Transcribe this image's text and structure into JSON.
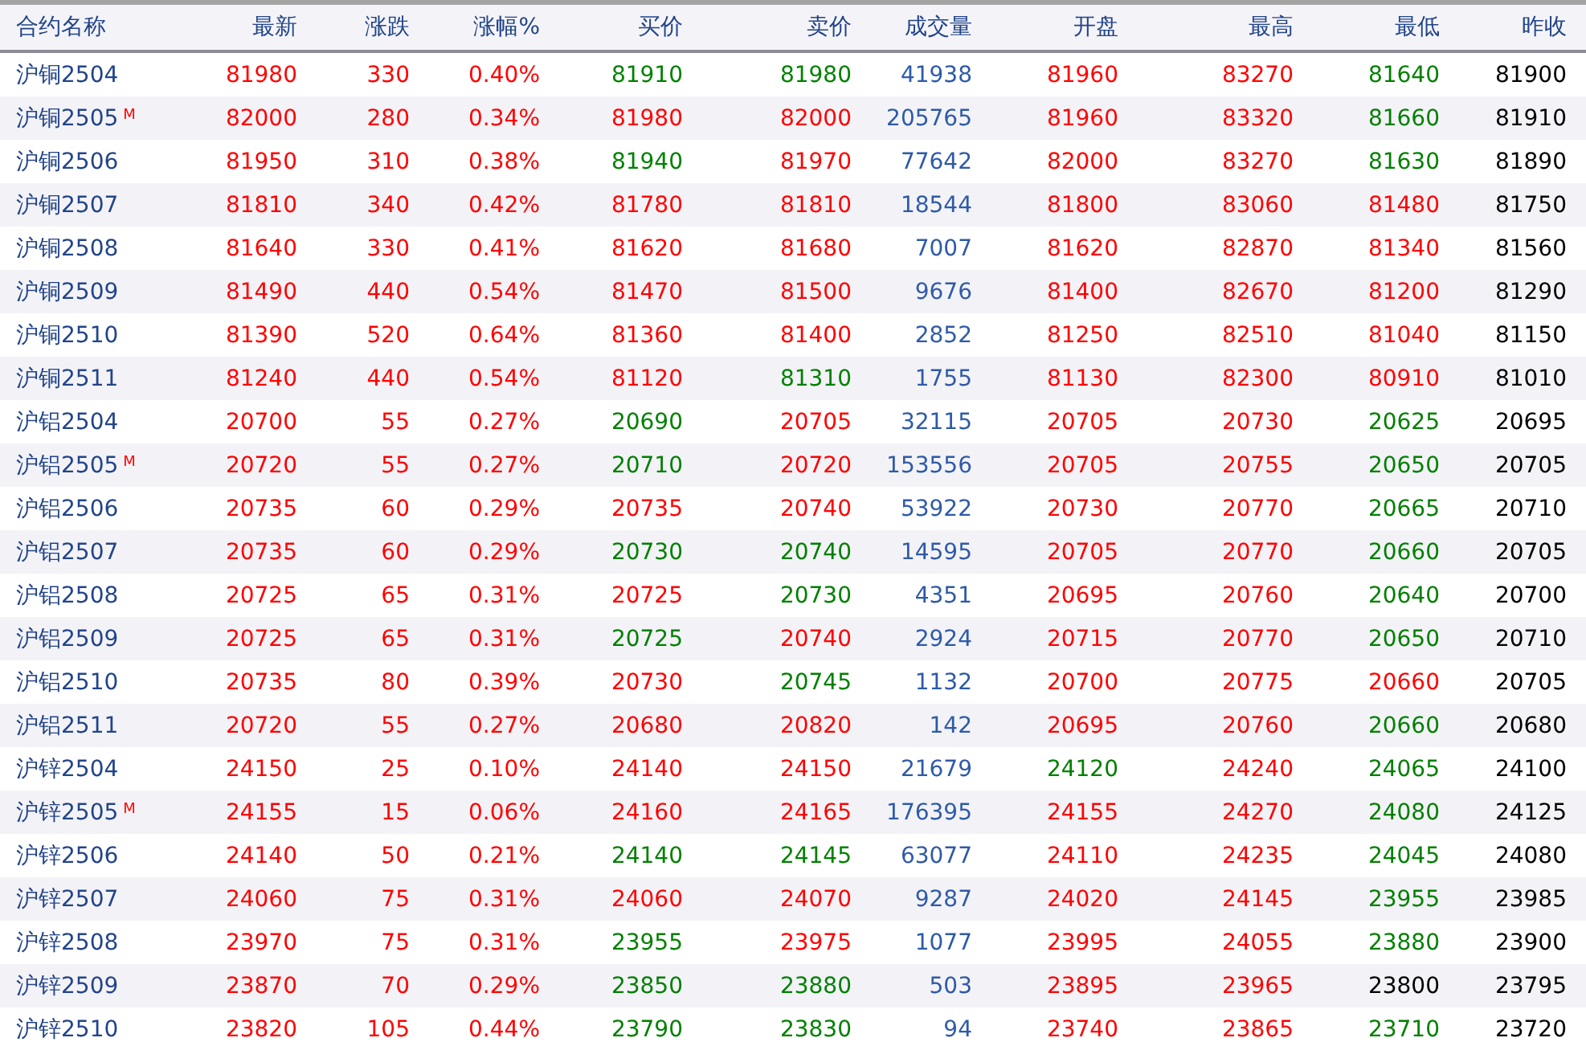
{
  "table": {
    "name_header": "合约名称",
    "columns": [
      "最新",
      "涨跌",
      "涨幅%",
      "买价",
      "卖价",
      "成交量",
      "开盘",
      "最高",
      "最低",
      "昨收"
    ],
    "rows": [
      {
        "name": "沪铜2504",
        "cells": [
          {
            "text": "81980",
            "color": "#ff0000"
          },
          {
            "text": "330",
            "color": "#ff0000"
          },
          {
            "text": "0.40%",
            "color": "#ff0000"
          },
          {
            "text": "81910",
            "color": "#008000"
          },
          {
            "text": "81980",
            "color": "#008000"
          },
          {
            "text": "41938",
            "color": "#2e5aa8"
          },
          {
            "text": "81960",
            "color": "#ff0000"
          },
          {
            "text": "83270",
            "color": "#ff0000"
          },
          {
            "text": "81640",
            "color": "#008000"
          },
          {
            "text": "81900",
            "color": "#000000"
          }
        ]
      },
      {
        "name": "沪铜2505",
        "badge": "M",
        "cells": [
          {
            "text": "82000",
            "color": "#ff0000"
          },
          {
            "text": "280",
            "color": "#ff0000"
          },
          {
            "text": "0.34%",
            "color": "#ff0000"
          },
          {
            "text": "81980",
            "color": "#ff0000"
          },
          {
            "text": "82000",
            "color": "#ff0000"
          },
          {
            "text": "205765",
            "color": "#2e5aa8"
          },
          {
            "text": "81960",
            "color": "#ff0000"
          },
          {
            "text": "83320",
            "color": "#ff0000"
          },
          {
            "text": "81660",
            "color": "#008000"
          },
          {
            "text": "81910",
            "color": "#000000"
          }
        ]
      },
      {
        "name": "沪铜2506",
        "cells": [
          {
            "text": "81950",
            "color": "#ff0000"
          },
          {
            "text": "310",
            "color": "#ff0000"
          },
          {
            "text": "0.38%",
            "color": "#ff0000"
          },
          {
            "text": "81940",
            "color": "#008000"
          },
          {
            "text": "81970",
            "color": "#ff0000"
          },
          {
            "text": "77642",
            "color": "#2e5aa8"
          },
          {
            "text": "82000",
            "color": "#ff0000"
          },
          {
            "text": "83270",
            "color": "#ff0000"
          },
          {
            "text": "81630",
            "color": "#008000"
          },
          {
            "text": "81890",
            "color": "#000000"
          }
        ]
      },
      {
        "name": "沪铜2507",
        "cells": [
          {
            "text": "81810",
            "color": "#ff0000"
          },
          {
            "text": "340",
            "color": "#ff0000"
          },
          {
            "text": "0.42%",
            "color": "#ff0000"
          },
          {
            "text": "81780",
            "color": "#ff0000"
          },
          {
            "text": "81810",
            "color": "#ff0000"
          },
          {
            "text": "18544",
            "color": "#2e5aa8"
          },
          {
            "text": "81800",
            "color": "#ff0000"
          },
          {
            "text": "83060",
            "color": "#ff0000"
          },
          {
            "text": "81480",
            "color": "#ff0000"
          },
          {
            "text": "81750",
            "color": "#000000"
          }
        ]
      },
      {
        "name": "沪铜2508",
        "cells": [
          {
            "text": "81640",
            "color": "#ff0000"
          },
          {
            "text": "330",
            "color": "#ff0000"
          },
          {
            "text": "0.41%",
            "color": "#ff0000"
          },
          {
            "text": "81620",
            "color": "#ff0000"
          },
          {
            "text": "81680",
            "color": "#ff0000"
          },
          {
            "text": "7007",
            "color": "#2e5aa8"
          },
          {
            "text": "81620",
            "color": "#ff0000"
          },
          {
            "text": "82870",
            "color": "#ff0000"
          },
          {
            "text": "81340",
            "color": "#ff0000"
          },
          {
            "text": "81560",
            "color": "#000000"
          }
        ]
      },
      {
        "name": "沪铜2509",
        "cells": [
          {
            "text": "81490",
            "color": "#ff0000"
          },
          {
            "text": "440",
            "color": "#ff0000"
          },
          {
            "text": "0.54%",
            "color": "#ff0000"
          },
          {
            "text": "81470",
            "color": "#ff0000"
          },
          {
            "text": "81500",
            "color": "#ff0000"
          },
          {
            "text": "9676",
            "color": "#2e5aa8"
          },
          {
            "text": "81400",
            "color": "#ff0000"
          },
          {
            "text": "82670",
            "color": "#ff0000"
          },
          {
            "text": "81200",
            "color": "#ff0000"
          },
          {
            "text": "81290",
            "color": "#000000"
          }
        ]
      },
      {
        "name": "沪铜2510",
        "cells": [
          {
            "text": "81390",
            "color": "#ff0000"
          },
          {
            "text": "520",
            "color": "#ff0000"
          },
          {
            "text": "0.64%",
            "color": "#ff0000"
          },
          {
            "text": "81360",
            "color": "#ff0000"
          },
          {
            "text": "81400",
            "color": "#ff0000"
          },
          {
            "text": "2852",
            "color": "#2e5aa8"
          },
          {
            "text": "81250",
            "color": "#ff0000"
          },
          {
            "text": "82510",
            "color": "#ff0000"
          },
          {
            "text": "81040",
            "color": "#ff0000"
          },
          {
            "text": "81150",
            "color": "#000000"
          }
        ]
      },
      {
        "name": "沪铜2511",
        "cells": [
          {
            "text": "81240",
            "color": "#ff0000"
          },
          {
            "text": "440",
            "color": "#ff0000"
          },
          {
            "text": "0.54%",
            "color": "#ff0000"
          },
          {
            "text": "81120",
            "color": "#ff0000"
          },
          {
            "text": "81310",
            "color": "#008000"
          },
          {
            "text": "1755",
            "color": "#2e5aa8"
          },
          {
            "text": "81130",
            "color": "#ff0000"
          },
          {
            "text": "82300",
            "color": "#ff0000"
          },
          {
            "text": "80910",
            "color": "#ff0000"
          },
          {
            "text": "81010",
            "color": "#000000"
          }
        ]
      },
      {
        "name": "沪铝2504",
        "cells": [
          {
            "text": "20700",
            "color": "#ff0000"
          },
          {
            "text": "55",
            "color": "#ff0000"
          },
          {
            "text": "0.27%",
            "color": "#ff0000"
          },
          {
            "text": "20690",
            "color": "#008000"
          },
          {
            "text": "20705",
            "color": "#ff0000"
          },
          {
            "text": "32115",
            "color": "#2e5aa8"
          },
          {
            "text": "20705",
            "color": "#ff0000"
          },
          {
            "text": "20730",
            "color": "#ff0000"
          },
          {
            "text": "20625",
            "color": "#008000"
          },
          {
            "text": "20695",
            "color": "#000000"
          }
        ]
      },
      {
        "name": "沪铝2505",
        "badge": "M",
        "cells": [
          {
            "text": "20720",
            "color": "#ff0000"
          },
          {
            "text": "55",
            "color": "#ff0000"
          },
          {
            "text": "0.27%",
            "color": "#ff0000"
          },
          {
            "text": "20710",
            "color": "#008000"
          },
          {
            "text": "20720",
            "color": "#ff0000"
          },
          {
            "text": "153556",
            "color": "#2e5aa8"
          },
          {
            "text": "20705",
            "color": "#ff0000"
          },
          {
            "text": "20755",
            "color": "#ff0000"
          },
          {
            "text": "20650",
            "color": "#008000"
          },
          {
            "text": "20705",
            "color": "#000000"
          }
        ]
      },
      {
        "name": "沪铝2506",
        "cells": [
          {
            "text": "20735",
            "color": "#ff0000"
          },
          {
            "text": "60",
            "color": "#ff0000"
          },
          {
            "text": "0.29%",
            "color": "#ff0000"
          },
          {
            "text": "20735",
            "color": "#ff0000"
          },
          {
            "text": "20740",
            "color": "#ff0000"
          },
          {
            "text": "53922",
            "color": "#2e5aa8"
          },
          {
            "text": "20730",
            "color": "#ff0000"
          },
          {
            "text": "20770",
            "color": "#ff0000"
          },
          {
            "text": "20665",
            "color": "#008000"
          },
          {
            "text": "20710",
            "color": "#000000"
          }
        ]
      },
      {
        "name": "沪铝2507",
        "cells": [
          {
            "text": "20735",
            "color": "#ff0000"
          },
          {
            "text": "60",
            "color": "#ff0000"
          },
          {
            "text": "0.29%",
            "color": "#ff0000"
          },
          {
            "text": "20730",
            "color": "#008000"
          },
          {
            "text": "20740",
            "color": "#008000"
          },
          {
            "text": "14595",
            "color": "#2e5aa8"
          },
          {
            "text": "20705",
            "color": "#ff0000"
          },
          {
            "text": "20770",
            "color": "#ff0000"
          },
          {
            "text": "20660",
            "color": "#008000"
          },
          {
            "text": "20705",
            "color": "#000000"
          }
        ]
      },
      {
        "name": "沪铝2508",
        "cells": [
          {
            "text": "20725",
            "color": "#ff0000"
          },
          {
            "text": "65",
            "color": "#ff0000"
          },
          {
            "text": "0.31%",
            "color": "#ff0000"
          },
          {
            "text": "20725",
            "color": "#ff0000"
          },
          {
            "text": "20730",
            "color": "#008000"
          },
          {
            "text": "4351",
            "color": "#2e5aa8"
          },
          {
            "text": "20695",
            "color": "#ff0000"
          },
          {
            "text": "20760",
            "color": "#ff0000"
          },
          {
            "text": "20640",
            "color": "#008000"
          },
          {
            "text": "20700",
            "color": "#000000"
          }
        ]
      },
      {
        "name": "沪铝2509",
        "cells": [
          {
            "text": "20725",
            "color": "#ff0000"
          },
          {
            "text": "65",
            "color": "#ff0000"
          },
          {
            "text": "0.31%",
            "color": "#ff0000"
          },
          {
            "text": "20725",
            "color": "#008000"
          },
          {
            "text": "20740",
            "color": "#ff0000"
          },
          {
            "text": "2924",
            "color": "#2e5aa8"
          },
          {
            "text": "20715",
            "color": "#ff0000"
          },
          {
            "text": "20770",
            "color": "#ff0000"
          },
          {
            "text": "20650",
            "color": "#008000"
          },
          {
            "text": "20710",
            "color": "#000000"
          }
        ]
      },
      {
        "name": "沪铝2510",
        "cells": [
          {
            "text": "20735",
            "color": "#ff0000"
          },
          {
            "text": "80",
            "color": "#ff0000"
          },
          {
            "text": "0.39%",
            "color": "#ff0000"
          },
          {
            "text": "20730",
            "color": "#ff0000"
          },
          {
            "text": "20745",
            "color": "#008000"
          },
          {
            "text": "1132",
            "color": "#2e5aa8"
          },
          {
            "text": "20700",
            "color": "#ff0000"
          },
          {
            "text": "20775",
            "color": "#ff0000"
          },
          {
            "text": "20660",
            "color": "#ff0000"
          },
          {
            "text": "20705",
            "color": "#000000"
          }
        ]
      },
      {
        "name": "沪铝2511",
        "cells": [
          {
            "text": "20720",
            "color": "#ff0000"
          },
          {
            "text": "55",
            "color": "#ff0000"
          },
          {
            "text": "0.27%",
            "color": "#ff0000"
          },
          {
            "text": "20680",
            "color": "#ff0000"
          },
          {
            "text": "20820",
            "color": "#ff0000"
          },
          {
            "text": "142",
            "color": "#2e5aa8"
          },
          {
            "text": "20695",
            "color": "#ff0000"
          },
          {
            "text": "20760",
            "color": "#ff0000"
          },
          {
            "text": "20660",
            "color": "#008000"
          },
          {
            "text": "20680",
            "color": "#000000"
          }
        ]
      },
      {
        "name": "沪锌2504",
        "cells": [
          {
            "text": "24150",
            "color": "#ff0000"
          },
          {
            "text": "25",
            "color": "#ff0000"
          },
          {
            "text": "0.10%",
            "color": "#ff0000"
          },
          {
            "text": "24140",
            "color": "#ff0000"
          },
          {
            "text": "24150",
            "color": "#ff0000"
          },
          {
            "text": "21679",
            "color": "#2e5aa8"
          },
          {
            "text": "24120",
            "color": "#008000"
          },
          {
            "text": "24240",
            "color": "#ff0000"
          },
          {
            "text": "24065",
            "color": "#008000"
          },
          {
            "text": "24100",
            "color": "#000000"
          }
        ]
      },
      {
        "name": "沪锌2505",
        "badge": "M",
        "cells": [
          {
            "text": "24155",
            "color": "#ff0000"
          },
          {
            "text": "15",
            "color": "#ff0000"
          },
          {
            "text": "0.06%",
            "color": "#ff0000"
          },
          {
            "text": "24160",
            "color": "#ff0000"
          },
          {
            "text": "24165",
            "color": "#ff0000"
          },
          {
            "text": "176395",
            "color": "#2e5aa8"
          },
          {
            "text": "24155",
            "color": "#ff0000"
          },
          {
            "text": "24270",
            "color": "#ff0000"
          },
          {
            "text": "24080",
            "color": "#008000"
          },
          {
            "text": "24125",
            "color": "#000000"
          }
        ]
      },
      {
        "name": "沪锌2506",
        "cells": [
          {
            "text": "24140",
            "color": "#ff0000"
          },
          {
            "text": "50",
            "color": "#ff0000"
          },
          {
            "text": "0.21%",
            "color": "#ff0000"
          },
          {
            "text": "24140",
            "color": "#008000"
          },
          {
            "text": "24145",
            "color": "#008000"
          },
          {
            "text": "63077",
            "color": "#2e5aa8"
          },
          {
            "text": "24110",
            "color": "#ff0000"
          },
          {
            "text": "24235",
            "color": "#ff0000"
          },
          {
            "text": "24045",
            "color": "#008000"
          },
          {
            "text": "24080",
            "color": "#000000"
          }
        ]
      },
      {
        "name": "沪锌2507",
        "cells": [
          {
            "text": "24060",
            "color": "#ff0000"
          },
          {
            "text": "75",
            "color": "#ff0000"
          },
          {
            "text": "0.31%",
            "color": "#ff0000"
          },
          {
            "text": "24060",
            "color": "#ff0000"
          },
          {
            "text": "24070",
            "color": "#ff0000"
          },
          {
            "text": "9287",
            "color": "#2e5aa8"
          },
          {
            "text": "24020",
            "color": "#ff0000"
          },
          {
            "text": "24145",
            "color": "#ff0000"
          },
          {
            "text": "23955",
            "color": "#008000"
          },
          {
            "text": "23985",
            "color": "#000000"
          }
        ]
      },
      {
        "name": "沪锌2508",
        "cells": [
          {
            "text": "23970",
            "color": "#ff0000"
          },
          {
            "text": "75",
            "color": "#ff0000"
          },
          {
            "text": "0.31%",
            "color": "#ff0000"
          },
          {
            "text": "23955",
            "color": "#008000"
          },
          {
            "text": "23975",
            "color": "#ff0000"
          },
          {
            "text": "1077",
            "color": "#2e5aa8"
          },
          {
            "text": "23995",
            "color": "#ff0000"
          },
          {
            "text": "24055",
            "color": "#ff0000"
          },
          {
            "text": "23880",
            "color": "#008000"
          },
          {
            "text": "23900",
            "color": "#000000"
          }
        ]
      },
      {
        "name": "沪锌2509",
        "cells": [
          {
            "text": "23870",
            "color": "#ff0000"
          },
          {
            "text": "70",
            "color": "#ff0000"
          },
          {
            "text": "0.29%",
            "color": "#ff0000"
          },
          {
            "text": "23850",
            "color": "#008000"
          },
          {
            "text": "23880",
            "color": "#008000"
          },
          {
            "text": "503",
            "color": "#2e5aa8"
          },
          {
            "text": "23895",
            "color": "#ff0000"
          },
          {
            "text": "23965",
            "color": "#ff0000"
          },
          {
            "text": "23800",
            "color": "#000000"
          },
          {
            "text": "23795",
            "color": "#000000"
          }
        ]
      },
      {
        "name": "沪锌2510",
        "cells": [
          {
            "text": "23820",
            "color": "#ff0000"
          },
          {
            "text": "105",
            "color": "#ff0000"
          },
          {
            "text": "0.44%",
            "color": "#ff0000"
          },
          {
            "text": "23790",
            "color": "#008000"
          },
          {
            "text": "23830",
            "color": "#008000"
          },
          {
            "text": "94",
            "color": "#2e5aa8"
          },
          {
            "text": "23740",
            "color": "#ff0000"
          },
          {
            "text": "23865",
            "color": "#ff0000"
          },
          {
            "text": "23710",
            "color": "#008000"
          },
          {
            "text": "23720",
            "color": "#000000"
          }
        ]
      }
    ]
  }
}
